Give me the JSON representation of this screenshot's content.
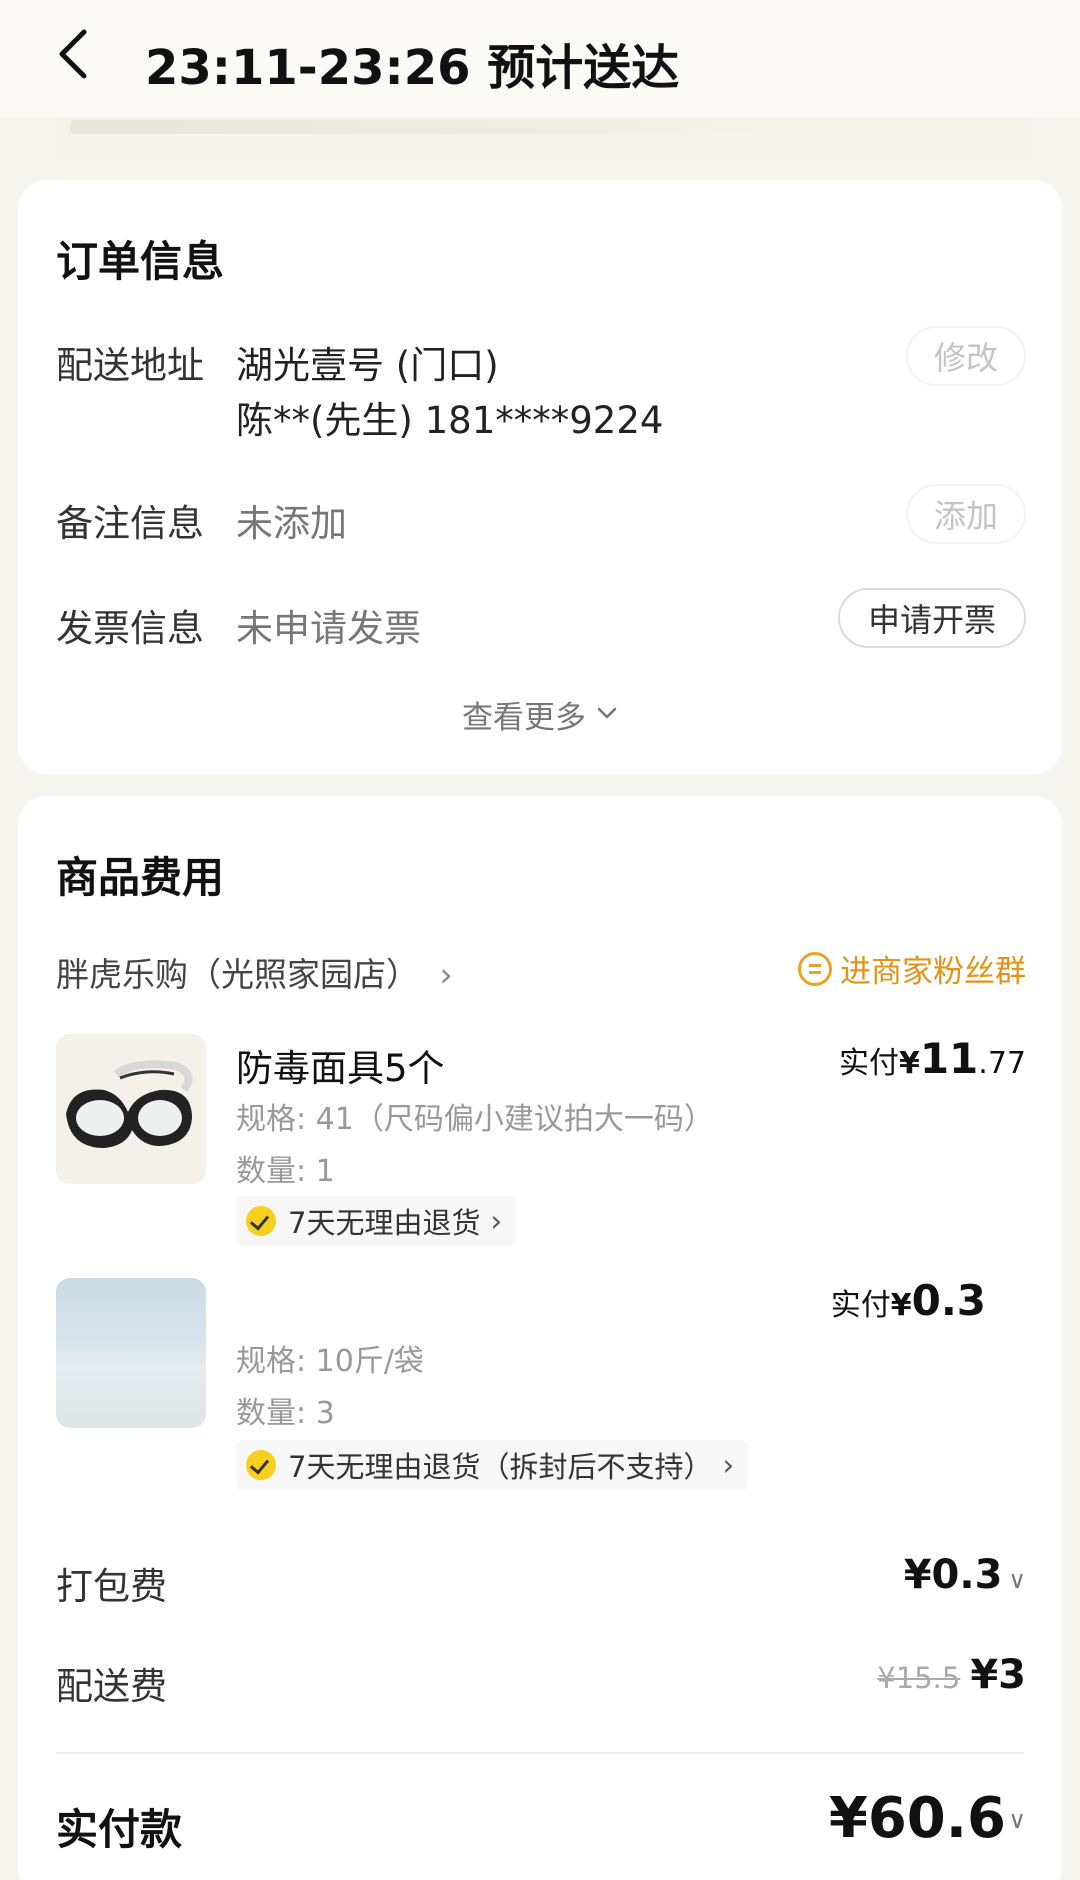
{
  "header": {
    "title": "23:11-23:26 预计送达"
  },
  "order_info": {
    "title": "订单信息",
    "address_label": "配送地址",
    "address_line1": "湖光壹号 (门口)",
    "address_line2": "陈**(先生) 181****9224",
    "address_action": "修改",
    "note_label": "备注信息",
    "note_value": "未添加",
    "note_action": "添加",
    "invoice_label": "发票信息",
    "invoice_value": "未申请发票",
    "invoice_action": "申请开票",
    "see_more": "查看更多"
  },
  "goods": {
    "title": "商品费用",
    "shop_name": "胖虎乐购（光照家园店）",
    "fans_group": "进商家粉丝群",
    "items": [
      {
        "name": "防毒面具5个",
        "spec": "规格: 41（尺码偏小建议拍大一码）",
        "qty": "数量: 1",
        "badge": "7天无理由退货",
        "paid_prefix": "实付",
        "paid_currency": "¥",
        "paid_int": "11",
        "paid_dec": ".77"
      },
      {
        "name": "",
        "spec": "规格: 10斤/袋",
        "qty": "数量: 3",
        "badge": "7天无理由退货（拆封后不支持）",
        "paid_prefix": "实付",
        "paid_currency": "¥",
        "paid_int": "0.3",
        "paid_dec": ""
      }
    ],
    "packing_label": "打包费",
    "packing_value": "¥0.3",
    "delivery_label": "配送费",
    "delivery_original": "¥15.5",
    "delivery_value": "¥3",
    "total_label": "实付款",
    "total_value": "¥60.6"
  },
  "colors": {
    "accent_orange": "#e59216",
    "badge_yellow": "#f7cf1f"
  }
}
